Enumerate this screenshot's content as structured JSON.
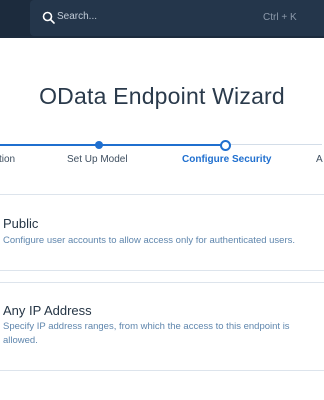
{
  "search": {
    "placeholder": "Search...",
    "shortcut": "Ctrl + K"
  },
  "page": {
    "title": "OData Endpoint Wizard"
  },
  "wizard": {
    "steps": [
      {
        "label": "tion",
        "state": "done"
      },
      {
        "label": "Set Up Model",
        "state": "done"
      },
      {
        "label": "Configure Security",
        "state": "current"
      },
      {
        "label": "A",
        "state": "upcoming"
      }
    ]
  },
  "options": [
    {
      "title": "Public",
      "description": "Configure user accounts to allow access only for authenticated users."
    },
    {
      "title": "Any IP Address",
      "description": "Specify IP address ranges, from which the access to this endpoint is allowed."
    }
  ],
  "colors": {
    "accent": "#1f6fcf",
    "topbar": "#1c2b3d",
    "description_text": "#5f86ad"
  }
}
